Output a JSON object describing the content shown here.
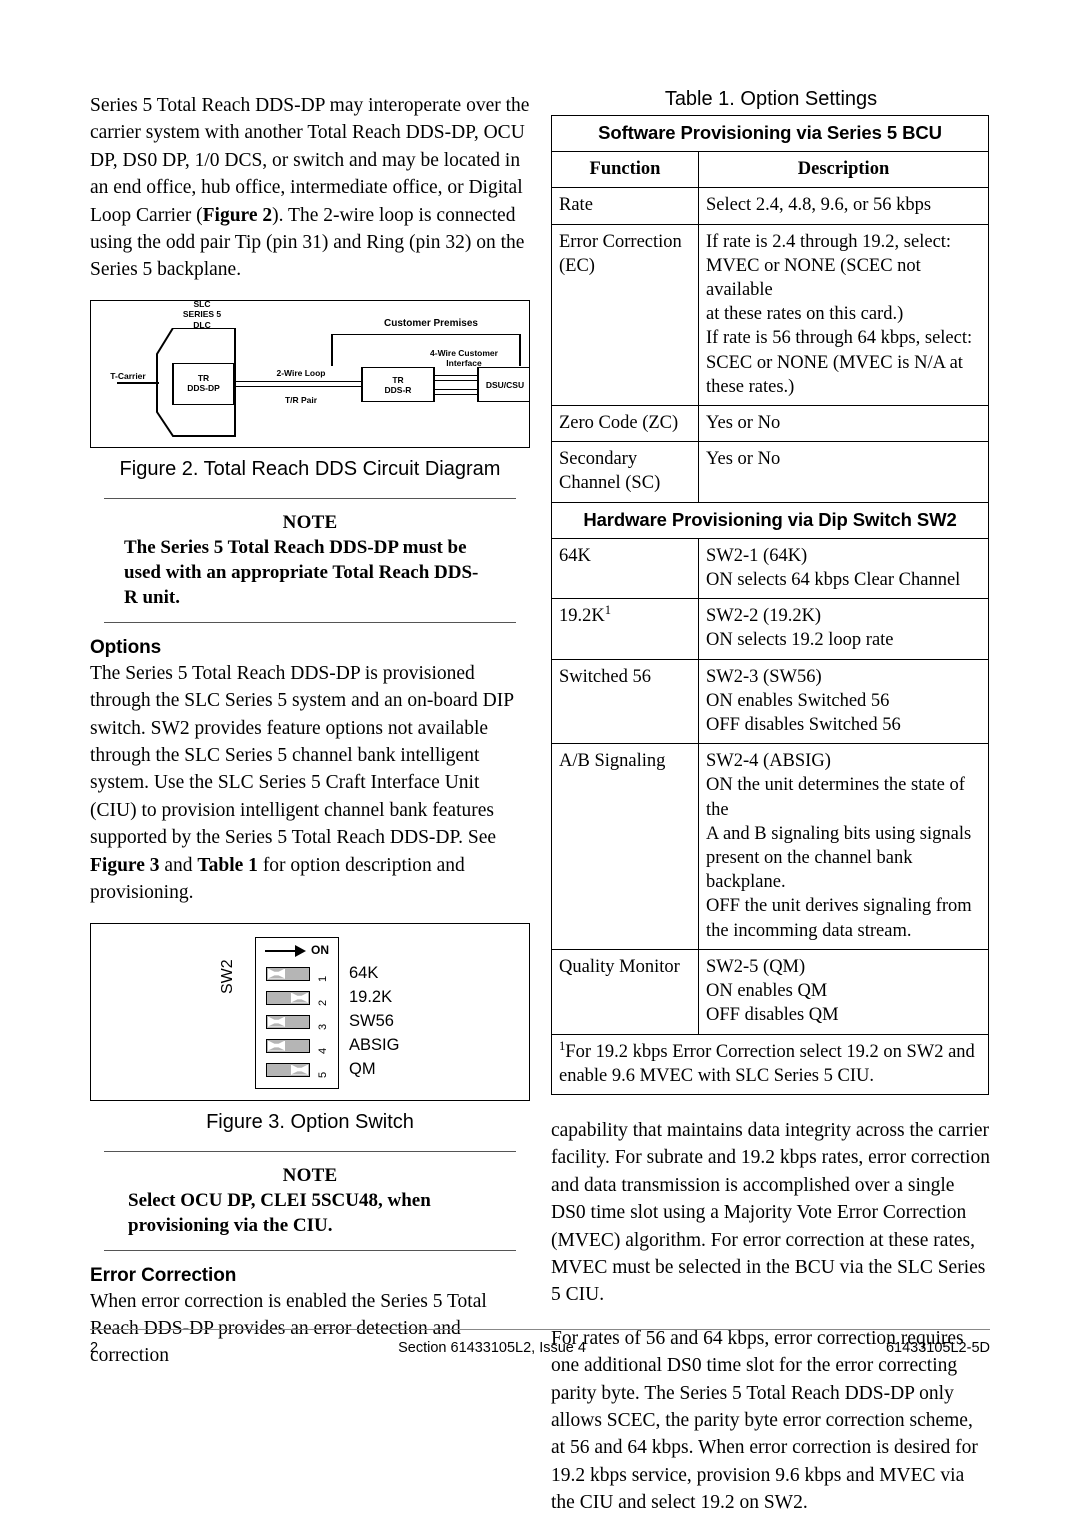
{
  "left_column": {
    "intro_paragraph": "Series 5 Total Reach DDS-DP may interoperate over the carrier system with another Total Reach DDS-DP, OCU DP, DS0 DP, 1/0 DCS, or switch and may be located in an end office, hub office, intermediate office, or Digital Loop Carrier (",
    "intro_bold": "Figure 2",
    "intro_paragraph_2": ").   The 2-wire loop is connected using the odd pair Tip  (pin 31) and Ring (pin 32) on the Series 5 backplane.",
    "figure2": {
      "caption": "Figure 2.  Total Reach DDS Circuit Diagram",
      "labels": {
        "t_carrier": "T-Carrier",
        "slc": "SLC\nSERIES 5\nDLC",
        "tr_dds_dp": "TR\nDDS-DP",
        "two_wire_loop": "2-Wire Loop",
        "tr_pair": "T/R Pair",
        "customer_premises": "Customer Premises",
        "four_wire": "4-Wire Customer\nInterface",
        "tr_dds_r": "TR\nDDS-R",
        "dsu_csu": "DSU/CSU"
      }
    },
    "note1": {
      "title": "NOTE",
      "line1": "The Series 5 Total Reach DDS-DP must be",
      "line2": "used with an appropriate Total Reach      DDS-",
      "line3": "R unit."
    },
    "options_heading": "Options",
    "options_paragraph_a": "The Series 5 Total Reach DDS-DP is provisioned through the SLC Series 5 system and an on-board DIP switch.  SW2 provides feature options not available through the SLC Series 5 channel bank intelligent system.  Use the SLC Series 5 Craft Interface Unit (CIU) to provision intelligent channel bank features supported by the Series 5 Total Reach DDS-DP.  See ",
    "options_bold_1": "Figure 3",
    "options_paragraph_b": " and ",
    "options_bold_2": "Table 1",
    "options_paragraph_c": " for option description and provisioning.",
    "figure3": {
      "caption": "Figure 3.  Option Switch",
      "switch_label": "SW2",
      "on_label": "ON",
      "switches": [
        {
          "number": "1",
          "name": "64K",
          "position": "left"
        },
        {
          "number": "2",
          "name": "19.2K",
          "position": "right"
        },
        {
          "number": "3",
          "name": "SW56",
          "position": "left"
        },
        {
          "number": "4",
          "name": "ABSIG",
          "position": "left"
        },
        {
          "number": "5",
          "name": "QM",
          "position": "right"
        }
      ]
    },
    "note2": {
      "title": "NOTE",
      "line1": "Select OCU DP, CLEI 5SCU48, when",
      "line2": "provisioning via the CIU."
    },
    "error_correction_heading": "Error Correction",
    "error_correction_paragraph": "When error correction is enabled the Series 5 Total Reach DDS-DP provides an error detection and correction"
  },
  "right_column": {
    "table": {
      "caption": "Table 1.  Option Settings",
      "section1_title": "Software Provisioning via Series 5 BCU",
      "col_header_function": "Function",
      "col_header_description": "Description",
      "software_rows": [
        {
          "function": "Rate",
          "description": "Select 2.4, 4.8, 9.6, or 56 kbps"
        },
        {
          "function": "Error Correction\n(EC)",
          "description": "If rate is 2.4 through 19.2, select:\nMVEC or NONE (SCEC not available\nat these rates on this card.)\nIf rate is 56 through 64 kbps, select:\nSCEC or NONE (MVEC is N/A at\nthese rates.)"
        },
        {
          "function": "Zero Code (ZC)",
          "description": "Yes or No"
        },
        {
          "function": "Secondary\nChannel (SC)",
          "description": "Yes or No"
        }
      ],
      "section2_title": "Hardware Provisioning via Dip Switch SW2",
      "hardware_rows": [
        {
          "function": "64K",
          "footnote_marker": "",
          "description": "SW2-1 (64K)\nON selects 64 kbps Clear Channel"
        },
        {
          "function": "19.2K",
          "footnote_marker": "1",
          "description": "SW2-2 (19.2K)\nON selects 19.2 loop rate"
        },
        {
          "function": "Switched 56",
          "footnote_marker": "",
          "description": "SW2-3 (SW56)\nON enables Switched 56\nOFF disables Switched 56"
        },
        {
          "function": "A/B Signaling",
          "footnote_marker": "",
          "description": "SW2-4 (ABSIG)\nON the unit determines the state of the\nA and B signaling bits using signals\npresent on the channel bank backplane.\nOFF the unit derives signaling from\nthe incomming data stream."
        },
        {
          "function": "Quality Monitor",
          "footnote_marker": "",
          "description": "SW2-5 (QM)\nON enables QM\nOFF disables QM"
        }
      ],
      "footnote_marker": "1",
      "footnote_text": "For 19.2 kbps Error Correction select 19.2 on SW2 and enable 9.6 MVEC with SLC Series 5 CIU."
    },
    "paragraph_1": "capability that maintains data integrity across the carrier facility.  For subrate and 19.2 kbps rates, error correction and data transmission is accomplished over a single DS0 time slot using a Majority Vote Error Correction (MVEC) algorithm.  For error correction at these rates, MVEC must be selected in the BCU via the SLC Series 5 CIU.",
    "paragraph_2": "For rates of 56 and 64 kbps, error correction requires one additional DS0 time slot for the error correcting parity byte.  The Series 5 Total Reach DDS-DP only allows SCEC, the parity byte error correction scheme, at 56 and 64 kbps. When error correction is desired for 19.2 kbps service, provision 9.6 kbps and MVEC via the CIU and select 19.2 on SW2."
  },
  "footer": {
    "page_number": "2",
    "section": "Section 61433105L2, Issue 4",
    "doc_id": "61433105L2-5D"
  }
}
